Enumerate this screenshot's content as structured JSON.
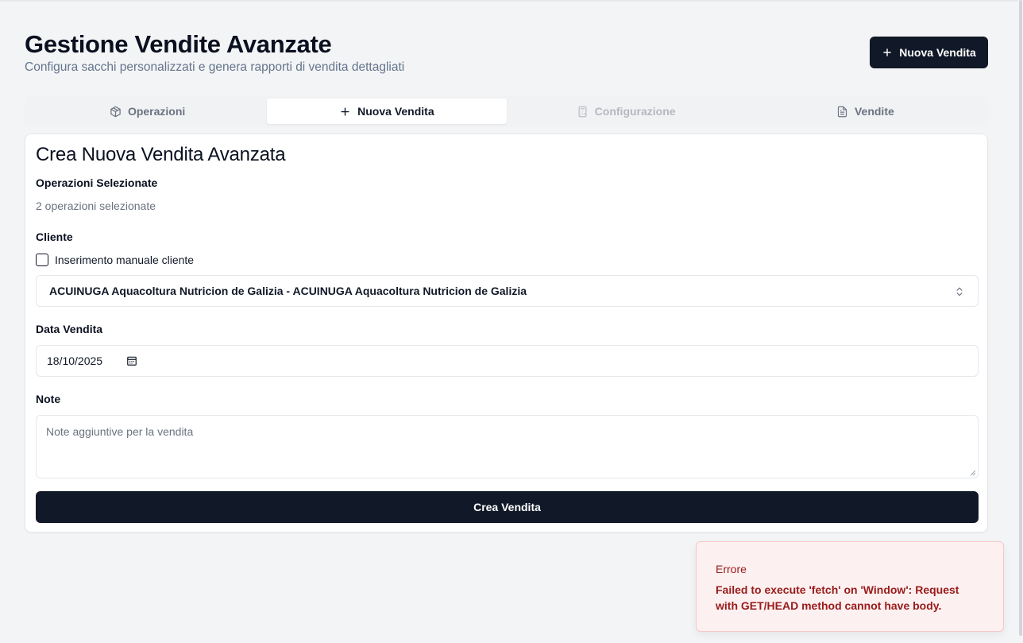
{
  "header": {
    "title": "Gestione Vendite Avanzate",
    "subtitle": "Configura sacchi personalizzati e genera rapporti di vendita dettagliati",
    "new_sale_button": "Nuova Vendita"
  },
  "tabs": [
    {
      "label": "Operazioni",
      "icon": "package-icon",
      "state": "inactive"
    },
    {
      "label": "Nuova Vendita",
      "icon": "plus-icon",
      "state": "active"
    },
    {
      "label": "Configurazione",
      "icon": "calculator-icon",
      "state": "disabled"
    },
    {
      "label": "Vendite",
      "icon": "file-text-icon",
      "state": "inactive"
    }
  ],
  "form": {
    "title": "Crea Nuova Vendita Avanzata",
    "operations_label": "Operazioni Selezionate",
    "operations_value": "2 operazioni selezionate",
    "client_label": "Cliente",
    "manual_client_label": "Inserimento manuale cliente",
    "manual_client_checked": false,
    "client_selected": "ACUINUGA Aquacoltura Nutricion de Galizia - ACUINUGA Aquacoltura Nutricion de Galizia",
    "date_label": "Data Vendita",
    "date_value": "18/10/2025",
    "notes_label": "Note",
    "notes_placeholder": "Note aggiuntive per la vendita",
    "submit_label": "Crea Vendita"
  },
  "toast": {
    "title": "Errore",
    "message": "Failed to execute 'fetch' on 'Window': Request with GET/HEAD method cannot have body."
  },
  "colors": {
    "primary": "#111827",
    "background": "#f3f4f6",
    "error_bg": "#fdf0f0",
    "error_text": "#991b1b"
  }
}
